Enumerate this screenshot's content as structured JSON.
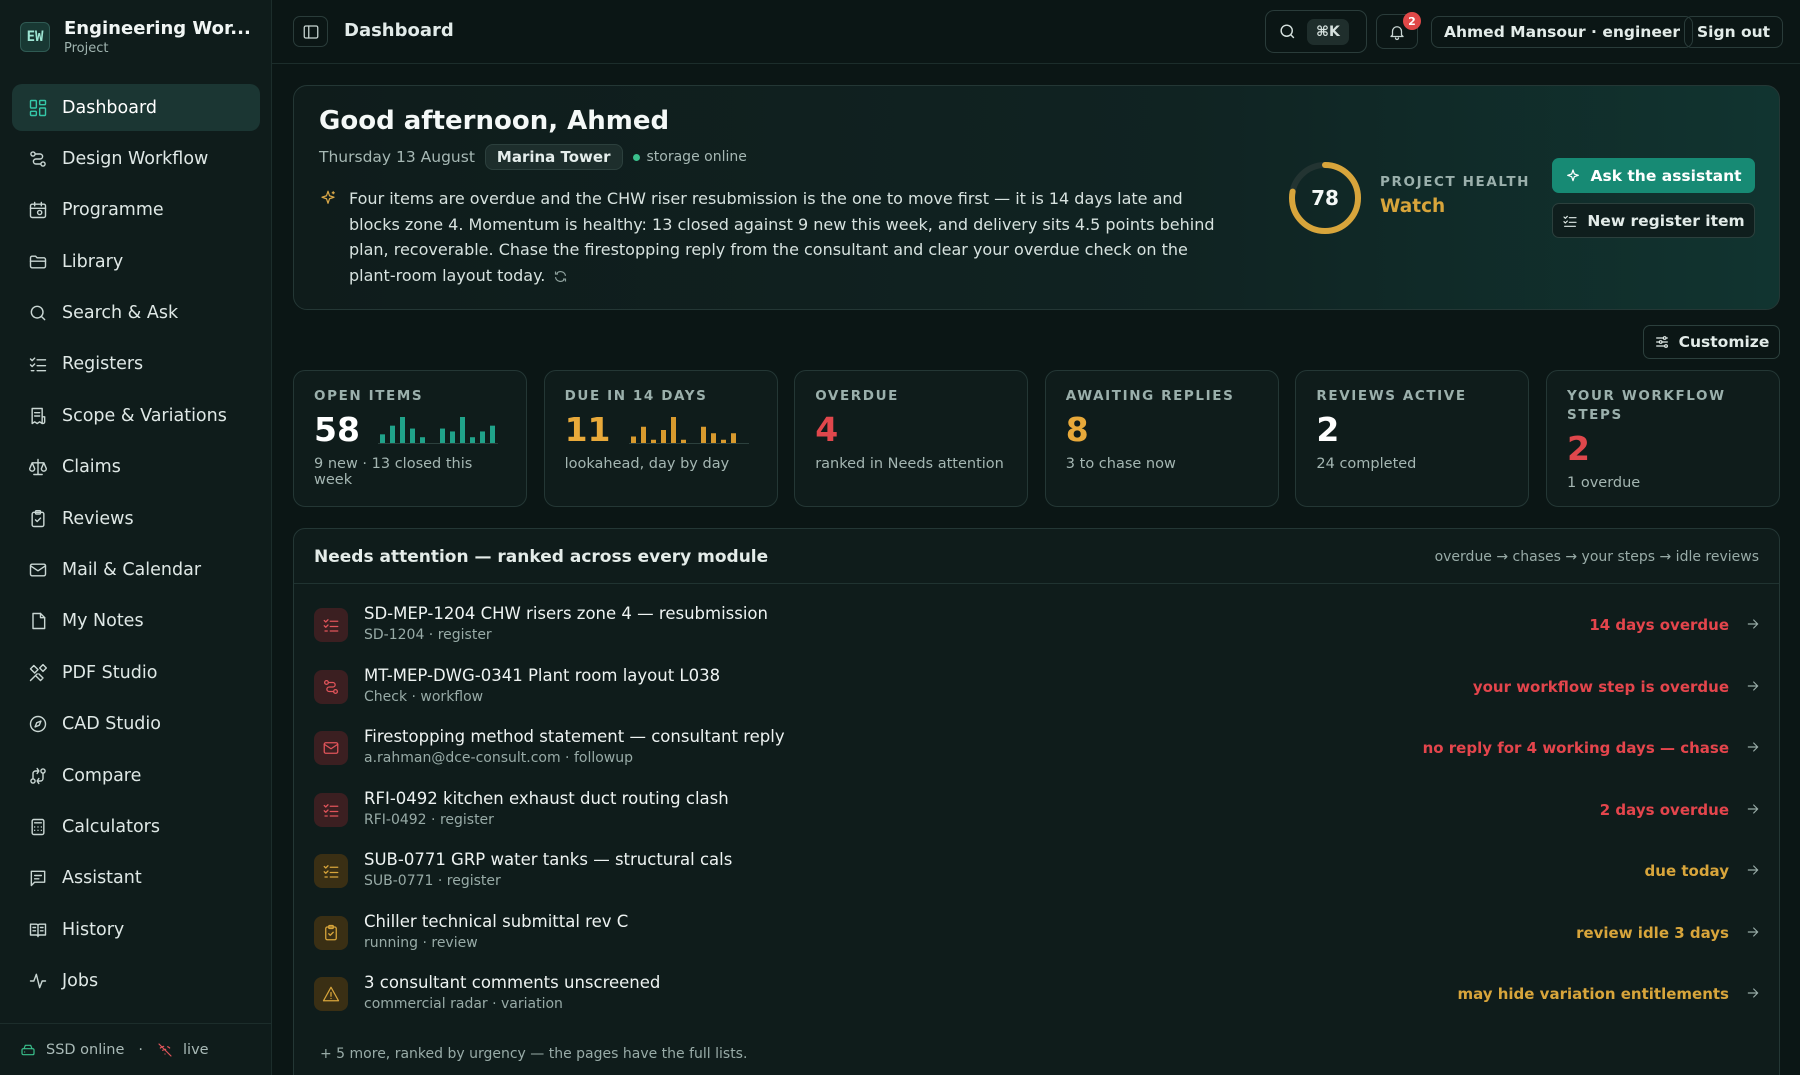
{
  "brand": {
    "logo": "EW",
    "title": "Engineering Wor...",
    "subtitle": "Project"
  },
  "nav": [
    {
      "label": "Dashboard",
      "icon": "grid-icon",
      "active": true
    },
    {
      "label": "Design Workflow",
      "icon": "workflow-icon"
    },
    {
      "label": "Programme",
      "icon": "calendar-icon"
    },
    {
      "label": "Library",
      "icon": "folder-icon"
    },
    {
      "label": "Search & Ask",
      "icon": "search-icon"
    },
    {
      "label": "Registers",
      "icon": "checklist-icon"
    },
    {
      "label": "Scope & Variations",
      "icon": "receipt-icon"
    },
    {
      "label": "Claims",
      "icon": "scale-icon"
    },
    {
      "label": "Reviews",
      "icon": "clipboard-icon"
    },
    {
      "label": "Mail & Calendar",
      "icon": "mail-icon"
    },
    {
      "label": "My Notes",
      "icon": "note-icon"
    },
    {
      "label": "PDF Studio",
      "icon": "tools-icon"
    },
    {
      "label": "CAD Studio",
      "icon": "compass-icon"
    },
    {
      "label": "Compare",
      "icon": "compare-icon"
    },
    {
      "label": "Calculators",
      "icon": "calculator-icon"
    },
    {
      "label": "Assistant",
      "icon": "chat-icon"
    },
    {
      "label": "History",
      "icon": "book-icon"
    },
    {
      "label": "Jobs",
      "icon": "activity-icon"
    }
  ],
  "footer": {
    "storage": "SSD online",
    "separator": "·",
    "live": "live"
  },
  "topbar": {
    "title": "Dashboard",
    "shortcut": "⌘K",
    "notifications": "2",
    "user": "Ahmed Mansour · engineer",
    "signout": "Sign out"
  },
  "hero": {
    "greeting": "Good afternoon, Ahmed",
    "date": "Thursday 13 August",
    "project": "Marina Tower",
    "storage_status": "storage online",
    "summary": "Four items are overdue and the CHW riser resubmission is the one to move first — it is 14 days late and blocks zone 4. Momentum is healthy: 13 closed against 9 new this week, and delivery sits 4.5 points behind plan, recoverable. Chase the firestopping reply from the consultant and clear your overdue check on the plant-room layout today.",
    "health_score": "78",
    "health_fraction": 0.78,
    "health_label": "PROJECT HEALTH",
    "health_state": "Watch",
    "ask_label": "Ask the assistant",
    "new_label": "New register item"
  },
  "customize_label": "Customize",
  "colors": {
    "accent": "#178a74",
    "teal": "#35c7a8",
    "amber": "#d8a53b",
    "red": "#e4454c"
  },
  "kpis": [
    {
      "label": "OPEN ITEMS",
      "value": "58",
      "sub": "9 new · 13 closed this week",
      "color": "#ffffff",
      "bars": [
        3,
        6,
        9,
        5,
        2,
        0,
        5,
        4,
        9,
        2,
        4,
        6
      ],
      "bar_color": "#20a38a"
    },
    {
      "label": "DUE IN 14 DAYS",
      "value": "11",
      "sub": "lookahead, day by day",
      "color": "#e8a93a",
      "bars": [
        2,
        5,
        1,
        4,
        8,
        1,
        0,
        5,
        3,
        1,
        3,
        0
      ],
      "bar_color": "#d89a2e"
    },
    {
      "label": "OVERDUE",
      "value": "4",
      "sub": "ranked in Needs attention",
      "color": "#e0474c"
    },
    {
      "label": "AWAITING REPLIES",
      "value": "8",
      "sub": "3 to chase now",
      "color": "#e8a93a"
    },
    {
      "label": "REVIEWS ACTIVE",
      "value": "2",
      "sub": "24 completed",
      "color": "#ffffff"
    },
    {
      "label": "YOUR WORKFLOW STEPS",
      "value": "2",
      "sub": "1 overdue",
      "color": "#e0474c"
    }
  ],
  "attention": {
    "title": "Needs attention — ranked across every module",
    "order": "overdue → chases → your steps → idle reviews",
    "items": [
      {
        "name": "SD-MEP-1204 CHW risers zone 4 — resubmission",
        "meta": "SD-1204 · register",
        "status": "14 days overdue",
        "tone": "red",
        "icon": "checklist-icon"
      },
      {
        "name": "MT-MEP-DWG-0341 Plant room layout L038",
        "meta": "Check · workflow",
        "status": "your workflow step is overdue",
        "tone": "red",
        "icon": "workflow-icon"
      },
      {
        "name": "Firestopping method statement — consultant reply",
        "meta": "a.rahman@dce-consult.com · followup",
        "status": "no reply for 4 working days — chase",
        "tone": "red",
        "icon": "mail-icon"
      },
      {
        "name": "RFI-0492 kitchen exhaust duct routing clash",
        "meta": "RFI-0492 · register",
        "status": "2 days overdue",
        "tone": "red",
        "icon": "checklist-icon"
      },
      {
        "name": "SUB-0771 GRP water tanks — structural cals",
        "meta": "SUB-0771 · register",
        "status": "due today",
        "tone": "amber",
        "icon": "checklist-icon"
      },
      {
        "name": "Chiller technical submittal rev C",
        "meta": "running · review",
        "status": "review idle 3 days",
        "tone": "amber",
        "icon": "clipboard-icon"
      },
      {
        "name": "3 consultant comments unscreened",
        "meta": "commercial radar · variation",
        "status": "may hide variation entitlements",
        "tone": "amber",
        "icon": "warning-icon"
      }
    ],
    "more": "+ 5 more, ranked by urgency — the pages have the full lists."
  }
}
